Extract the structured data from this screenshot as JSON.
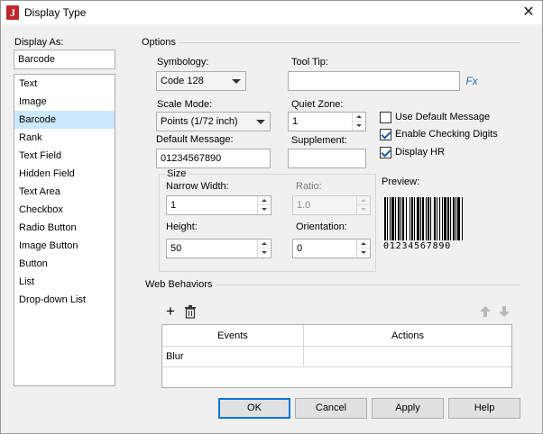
{
  "window": {
    "title": "Display Type",
    "icon_letter": "J",
    "close_glyph": "✕"
  },
  "display_as": {
    "label": "Display As:",
    "value": "Barcode",
    "items": [
      "Text",
      "Image",
      "Barcode",
      "Rank",
      "Text Field",
      "Hidden Field",
      "Text Area",
      "Checkbox",
      "Radio Button",
      "Image Button",
      "Button",
      "List",
      "Drop-down List"
    ],
    "selected_index": 2
  },
  "options": {
    "section_label": "Options",
    "symbology": {
      "label": "Symbology:",
      "value": "Code 128"
    },
    "tool_tip": {
      "label": "Tool Tip:",
      "value": "",
      "fx_label": "Fx"
    },
    "scale_mode": {
      "label": "Scale Mode:",
      "value": "Points (1/72 inch)"
    },
    "quiet_zone": {
      "label": "Quiet Zone:",
      "value": "1"
    },
    "default_message": {
      "label": "Default Message:",
      "value": "01234567890"
    },
    "supplement": {
      "label": "Supplement:",
      "value": ""
    },
    "use_default_message": {
      "label": "Use Default Message",
      "checked": false
    },
    "enable_checking_digits": {
      "label": "Enable Checking Digits",
      "checked": true
    },
    "display_hr": {
      "label": "Display HR",
      "checked": true
    },
    "size": {
      "label": "Size",
      "narrow_width": {
        "label": "Narrow Width:",
        "value": "1"
      },
      "ratio": {
        "label": "Ratio:",
        "value": "1.0",
        "disabled": true
      },
      "height": {
        "label": "Height:",
        "value": "50"
      },
      "orientation": {
        "label": "Orientation:",
        "value": "0"
      }
    },
    "preview": {
      "label": "Preview:",
      "digits": "01234567890"
    }
  },
  "web_behaviors": {
    "section_label": "Web Behaviors",
    "add_icon": "+",
    "columns": [
      "Events",
      "Actions"
    ],
    "rows": [
      {
        "event": "Blur",
        "action": ""
      }
    ]
  },
  "buttons": {
    "ok": "OK",
    "cancel": "Cancel",
    "apply": "Apply",
    "help": "Help"
  },
  "colors": {
    "selection": "#cce8ff",
    "accent": "#0078d7",
    "app_icon": "#c0282d"
  }
}
